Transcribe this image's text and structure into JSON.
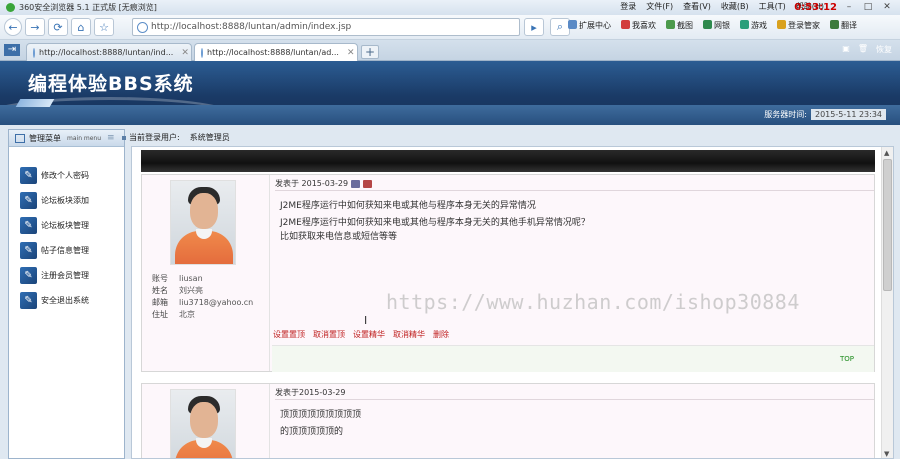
{
  "browser": {
    "title": "360安全浏览器 5.1 正式版 [无痕浏览]",
    "menus": [
      "登录",
      "文件(F)",
      "查看(V)",
      "收藏(B)",
      "工具(T)",
      "帮助(H)"
    ],
    "timer": "0:53:12",
    "address": "http://localhost:8888/luntan/admin/index.jsp",
    "toolbar_items": [
      "扩展中心",
      "我喜欢",
      "截图",
      "网银",
      "游戏",
      "登录管家",
      "翻译"
    ],
    "tabs": [
      {
        "label": "http://localhost:8888/luntan/ind..."
      },
      {
        "label": "http://localhost:8888/luntan/ad..."
      }
    ],
    "tabbar_right": "恢复"
  },
  "header": {
    "brand": "编程体验BBS系统",
    "server_time_label": "服务器时间:",
    "server_time_value": "2015-5-11 23:34"
  },
  "sidebar": {
    "title": "管理菜单",
    "title_en": "main menu",
    "items": [
      {
        "label": "修改个人密码"
      },
      {
        "label": "论坛板块添加"
      },
      {
        "label": "论坛板块管理"
      },
      {
        "label": "帖子信息管理"
      },
      {
        "label": "注册会员管理"
      },
      {
        "label": "安全退出系统"
      }
    ]
  },
  "user": {
    "label": "当前登录用户:",
    "name": "系统管理员"
  },
  "posts": [
    {
      "date": "发表于 2015-03-29",
      "title": "J2ME程序运行中如何获知来电或其他与程序本身无关的异常情况",
      "body": [
        "J2ME程序运行中如何获知来电或其他与程序本身无关的其他手机异常情况呢？",
        "比如获取来电信息或短信等等"
      ],
      "author": {
        "labels": {
          "account": "账号",
          "name": "姓名",
          "email": "邮箱",
          "address": "住址"
        },
        "account": "liusan",
        "name": "刘兴亮",
        "email": "liu3718@yahoo.cn",
        "address": "北京"
      },
      "actions": [
        "设置置顶",
        "取消置顶",
        "设置精华",
        "取消精华",
        "删除"
      ],
      "top_link": "TOP"
    },
    {
      "date": "发表于2015-03-29",
      "title": "顶顶顶顶顶顶顶顶顶",
      "body": [
        "的顶顶顶顶顶的"
      ]
    }
  ],
  "watermark": "https://www.huzhan.com/ishop30884"
}
